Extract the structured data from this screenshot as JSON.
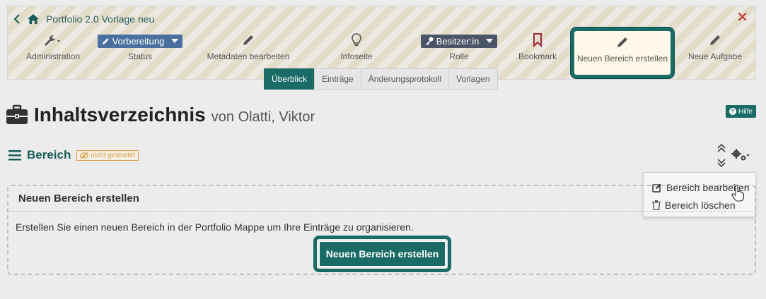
{
  "header": {
    "title": "Portfolio 2.0 Vorlage neu"
  },
  "toolbar": {
    "administration": {
      "label": "Administration"
    },
    "status": {
      "value": "Vorbereitung",
      "label": "Status"
    },
    "metadata": {
      "label": "Metadaten bearbeiten"
    },
    "info_page": {
      "label": "Infoseite"
    },
    "role": {
      "value": "Besitzer:in",
      "label": "Rolle"
    },
    "bookmark": {
      "label": "Bookmark"
    },
    "new_area": {
      "label": "Neuen Bereich erstellen"
    },
    "new_task": {
      "label": "Neue Aufgabe"
    }
  },
  "tabs": [
    {
      "label": "Überblick",
      "active": true
    },
    {
      "label": "Einträge"
    },
    {
      "label": "Änderungsprotokoll"
    },
    {
      "label": "Vorlagen"
    }
  ],
  "page": {
    "title": "Inhaltsverzeichnis",
    "owner": "von Olatti, Viktor",
    "help_label": "Hilfe"
  },
  "section": {
    "title": "Bereich",
    "status": "nicht gestartet"
  },
  "dropdown": {
    "edit": "Bereich bearbeiten",
    "delete": "Bereich löschen"
  },
  "panel": {
    "title": "Neuen Bereich erstellen",
    "description": "Erstellen Sie einen neuen Bereich in der Portfolio Mappe um Ihre Einträge zu organisieren.",
    "button": "Neuen Bereich erstellen"
  },
  "colors": {
    "primary": "#1a6b66",
    "close": "#c0262e",
    "warning": "#d9a24a"
  }
}
